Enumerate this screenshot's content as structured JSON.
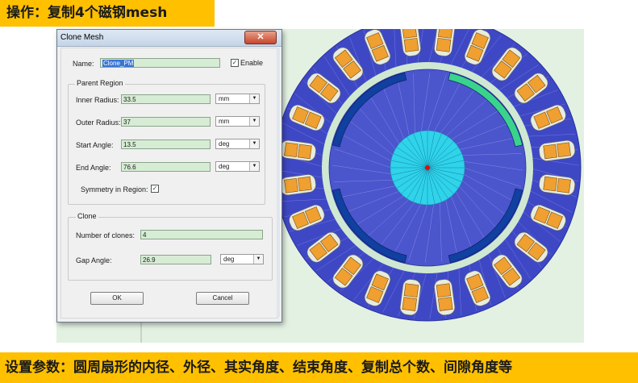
{
  "top_banner": "操作：复制4个磁钢mesh",
  "bottom_banner": "设置参数：圆周扇形的内径、外径、其实角度、结束角度、复制总个数、间隙角度等",
  "dialog": {
    "title": "Clone Mesh",
    "close_glyph": "✕",
    "name_label": "Name:",
    "name_value": "Clone_PM",
    "enable_label": "Enable",
    "enable_checked": "✓",
    "parent_region": {
      "title": "Parent Region",
      "inner_radius_label": "Inner Radius:",
      "inner_radius_value": "33.5",
      "inner_radius_unit": "mm",
      "outer_radius_label": "Outer Radius:",
      "outer_radius_value": "37",
      "outer_radius_unit": "mm",
      "start_angle_label": "Start Angle:",
      "start_angle_value": "13.5",
      "start_angle_unit": "deg",
      "end_angle_label": "End Angle:",
      "end_angle_value": "76.6",
      "end_angle_unit": "deg",
      "symmetry_label": "Symmetry in Region:",
      "symmetry_checked": "✓"
    },
    "clone": {
      "title": "Clone",
      "number_label": "Number of clones:",
      "number_value": "4",
      "gap_label": "Gap Angle:",
      "gap_value": "26.9",
      "gap_unit": "deg"
    },
    "ok_label": "OK",
    "cancel_label": "Cancel",
    "dropdown_arrow": "▼"
  },
  "mesh_view": {
    "stator_color": "#3f48c4",
    "rotor_color": "#4b55cc",
    "air_gap_color": "#cfe8d2",
    "magnet_color": "#1040a0",
    "selected_magnet_color": "#3ad38c",
    "coil_color": "#f0a030",
    "shaft_color": "#2fd3ea",
    "slot_count": 24
  }
}
